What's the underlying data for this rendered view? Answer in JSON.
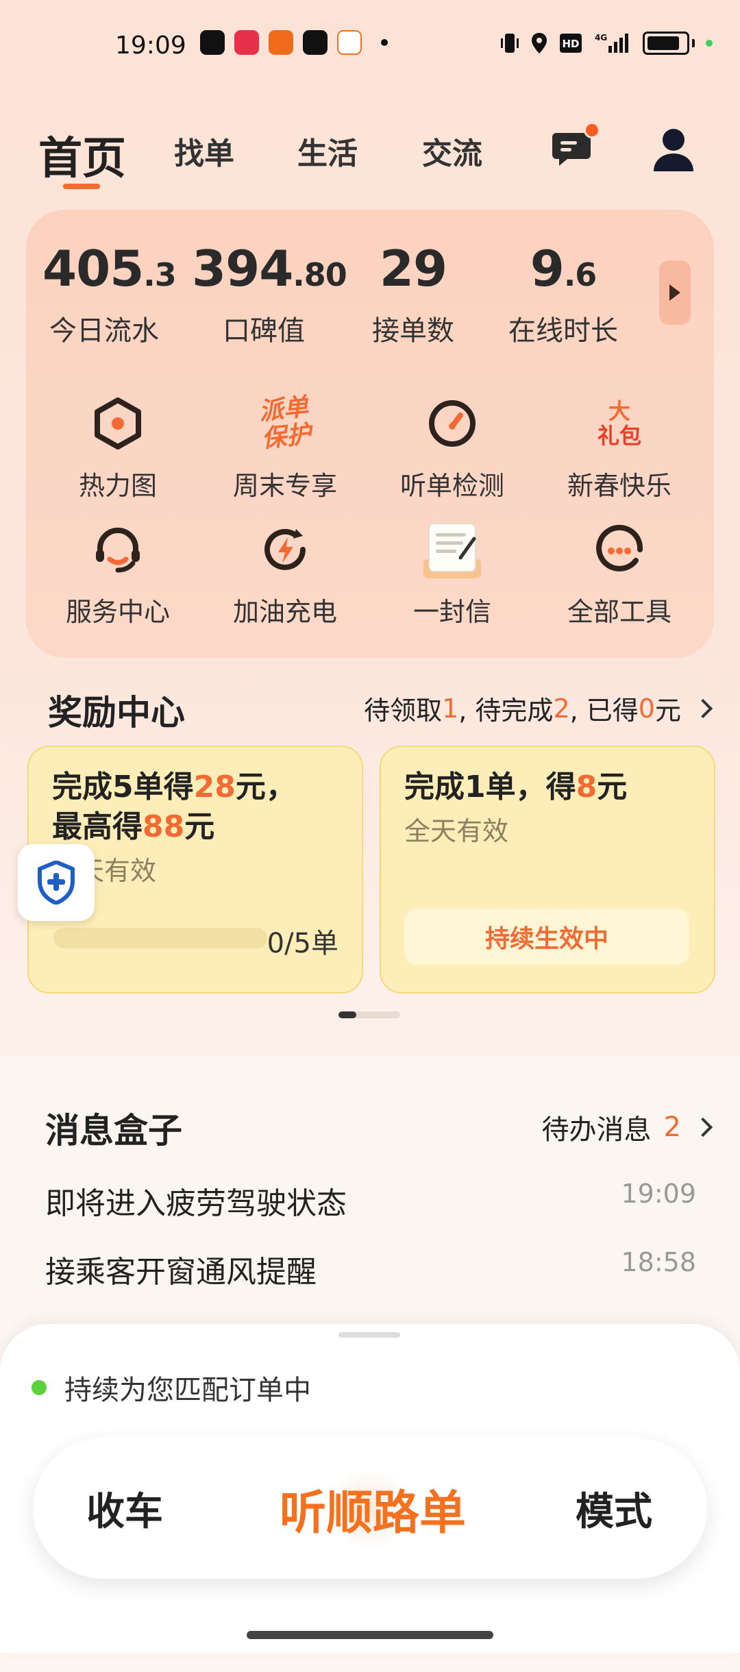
{
  "status_bar": {
    "time": "19:09",
    "network": "4G"
  },
  "nav": {
    "tabs": [
      {
        "label": "首页",
        "active": true
      },
      {
        "label": "找单"
      },
      {
        "label": "生活"
      },
      {
        "label": "交流"
      }
    ]
  },
  "stats": [
    {
      "value": "405",
      "decimal": ".3",
      "label": "今日流水"
    },
    {
      "value": "394",
      "decimal": ".80",
      "label": "口碑值"
    },
    {
      "value": "29",
      "decimal": "",
      "label": "接单数"
    },
    {
      "value": "9",
      "decimal": ".6",
      "label": "在线时长"
    }
  ],
  "tools": [
    {
      "label": "热力图",
      "icon": "heatmap-icon"
    },
    {
      "label": "周末专享",
      "icon": "dispatch-protect-icon",
      "icon_text": [
        "派单",
        "保护"
      ]
    },
    {
      "label": "听单检测",
      "icon": "gauge-icon"
    },
    {
      "label": "新春快乐",
      "icon": "big-gift-icon",
      "icon_text": [
        "大",
        "礼包"
      ]
    },
    {
      "label": "服务中心",
      "icon": "headset-icon"
    },
    {
      "label": "加油充电",
      "icon": "charge-icon"
    },
    {
      "label": "一封信",
      "icon": "letter-icon"
    },
    {
      "label": "全部工具",
      "icon": "more-icon"
    }
  ],
  "rewards": {
    "title": "奖励中心",
    "status": {
      "pending_claim_label": "待领取",
      "pending_claim": "1",
      "to_complete_label": ", 待完成",
      "to_complete": "2",
      "earned_label": ", 已得",
      "earned": "0",
      "unit": "元"
    },
    "cards": [
      {
        "line1_a": "完成5单得",
        "line1_b": "28",
        "line1_c": "元，",
        "line2_a": "最高得",
        "line2_b": "88",
        "line2_c": "元",
        "sub": "全天有效",
        "progress": 0,
        "progress_text": "0/5单"
      },
      {
        "line1_a": "完成1单，得",
        "line1_b": "8",
        "line1_c": "元",
        "sub": "全天有效",
        "button": "持续生效中"
      }
    ]
  },
  "messages": {
    "title": "消息盒子",
    "pending_label": "待办消息",
    "pending_count": "2",
    "items": [
      {
        "text": "即将进入疲劳驾驶状态",
        "time": "19:09"
      },
      {
        "text": "接乘客开窗通风提醒",
        "time": "18:58"
      }
    ]
  },
  "sheet": {
    "status": "持续为您匹配订单中",
    "left": "收车",
    "center": "听顺路单",
    "right": "模式"
  },
  "colors": {
    "accent": "#f36b33",
    "card_bg": "#fbd2bf",
    "reward_card": "#fdeeb9"
  }
}
